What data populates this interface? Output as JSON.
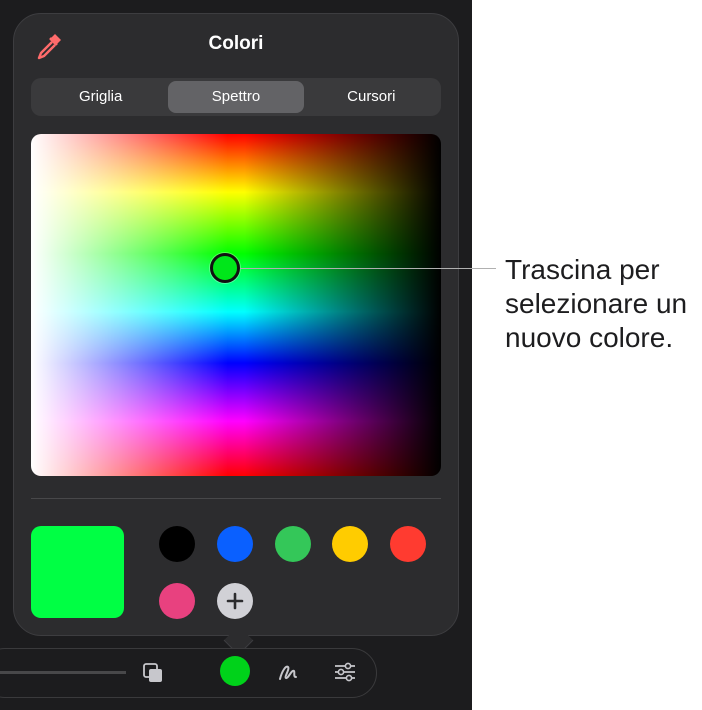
{
  "panel": {
    "title": "Colori",
    "eyedropper_icon": "eyedropper-icon",
    "tabs": [
      {
        "label": "Griglia",
        "active": false
      },
      {
        "label": "Spettro",
        "active": true
      },
      {
        "label": "Cursori",
        "active": false
      }
    ],
    "spectrum": {
      "selected_color": "#00e61a"
    },
    "current_color": "#00ff44",
    "swatches": [
      {
        "color": "#000000"
      },
      {
        "color": "#0a60ff"
      },
      {
        "color": "#34c759"
      },
      {
        "color": "#ffcc00"
      },
      {
        "color": "#ff3b30"
      },
      {
        "color": "#e8417f"
      }
    ],
    "add_icon": "plus-icon"
  },
  "callout": {
    "text": "Trascina per selezionare un nuovo colore."
  },
  "toolbar": {
    "copy_icon": "layers-icon",
    "color_well": "#00d21a",
    "pen_icon": "pen-icon",
    "settings_icon": "sliders-icon"
  }
}
